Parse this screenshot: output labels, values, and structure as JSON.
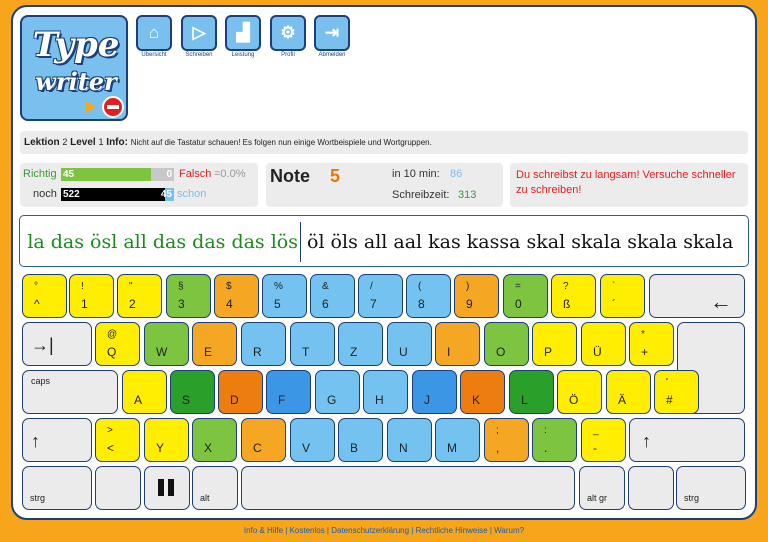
{
  "logo": {
    "line1": "Type",
    "line2": "writer"
  },
  "nav": [
    {
      "icon": "⌂",
      "label": "Übersicht",
      "name": "uebersicht"
    },
    {
      "icon": "▷",
      "label": "Schreiben",
      "name": "schreiben"
    },
    {
      "icon": "▟",
      "label": "Leistung",
      "name": "leistung"
    },
    {
      "icon": "⚙",
      "label": "Profil",
      "name": "profil"
    },
    {
      "icon": "⇥",
      "label": "Abmelden",
      "name": "abmelden"
    }
  ],
  "lesson": {
    "lektion_label": "Lektion",
    "lektion": "2",
    "level_label": "Level",
    "level": "1",
    "info_label": "Info:",
    "info": "Nicht auf die Tastatur schauen! Es folgen nun einige Wortbeispiele und Wortgruppen."
  },
  "stats": {
    "richtig_label": "Richtig",
    "richtig": "45",
    "falsch_count": "0",
    "falsch_label": "Falsch",
    "falsch_pct": "=0.0%",
    "noch_label": "noch",
    "noch": "522",
    "schon": "45",
    "schon_label": "schon",
    "richtig_fraction": 0.8,
    "noch_fraction": 0.92
  },
  "grade": {
    "label": "Note",
    "value": "5",
    "in10_label": "in 10 min:",
    "in10": "86",
    "zeit_label": "Schreibzeit:",
    "zeit": "313"
  },
  "warning": "Du schreibst zu langsam! Versuche schneller zu schreiben!",
  "text": {
    "typed": "la das ösl all das das das lös",
    "remaining": "öl öls all aal kas kassa skal skala skala skala"
  },
  "footer": "Info & Hilfe | Kostenlos | Datenschutzerklärung | Rechtliche Hinweise | Warum?",
  "colors": {
    "yellow": "#ffee00",
    "lime": "#7dc540",
    "orange": "#f5a623",
    "blue": "#73c2f0",
    "gray": "#ebebeb",
    "green": "#2aa02a",
    "darkorange": "#ee7d10",
    "midblue": "#3b96e6",
    "accent": "#f7a51b",
    "navy": "#1d3f78"
  },
  "keys": {
    "row1": [
      {
        "t": "°",
        "m": "^"
      },
      {
        "t": "!",
        "m": "1"
      },
      {
        "t": "\"",
        "m": "2"
      },
      {
        "t": "§",
        "m": "3"
      },
      {
        "t": "$",
        "m": "4"
      },
      {
        "t": "%",
        "m": "5"
      },
      {
        "t": "&",
        "m": "6"
      },
      {
        "t": "/",
        "m": "7"
      },
      {
        "t": "(",
        "m": "8"
      },
      {
        "t": ")",
        "m": "9"
      },
      {
        "t": "=",
        "m": "0"
      },
      {
        "t": "?",
        "m": "ß"
      },
      {
        "t": "`",
        "m": "´"
      },
      {
        "big": "←"
      }
    ],
    "row2": [
      {
        "big": "→|"
      },
      {
        "t": "@",
        "m": "Q"
      },
      {
        "m": "W"
      },
      {
        "m": "E"
      },
      {
        "m": "R"
      },
      {
        "m": "T"
      },
      {
        "m": "Z"
      },
      {
        "m": "U"
      },
      {
        "m": "I"
      },
      {
        "m": "O"
      },
      {
        "m": "P"
      },
      {
        "m": "Ü"
      },
      {
        "t": "*",
        "m": "+"
      }
    ],
    "row3": [
      {
        "side": "caps"
      },
      {
        "m": "A"
      },
      {
        "m": "S"
      },
      {
        "m": "D"
      },
      {
        "m": "F"
      },
      {
        "m": "G"
      },
      {
        "m": "H"
      },
      {
        "m": "J"
      },
      {
        "m": "K"
      },
      {
        "m": "L"
      },
      {
        "m": "Ö"
      },
      {
        "m": "Ä"
      },
      {
        "t": "'",
        "m": "#"
      }
    ],
    "row4": [
      {
        "big": "↑"
      },
      {
        "t": ">",
        "m": "<"
      },
      {
        "m": "Y"
      },
      {
        "m": "X"
      },
      {
        "m": "C"
      },
      {
        "m": "V"
      },
      {
        "m": "B"
      },
      {
        "m": "N"
      },
      {
        "m": "M"
      },
      {
        "t": ";",
        "m": ","
      },
      {
        "t": ":",
        "m": "."
      },
      {
        "t": "_",
        "m": "-"
      },
      {
        "big": "↑"
      }
    ],
    "row5": [
      {
        "m": "strg"
      },
      {
        "m": ""
      },
      {
        "pause": true
      },
      {
        "m": "alt"
      },
      {
        "m": ""
      },
      {
        "m": "alt gr"
      },
      {
        "m": ""
      },
      {
        "m": "strg"
      }
    ]
  }
}
